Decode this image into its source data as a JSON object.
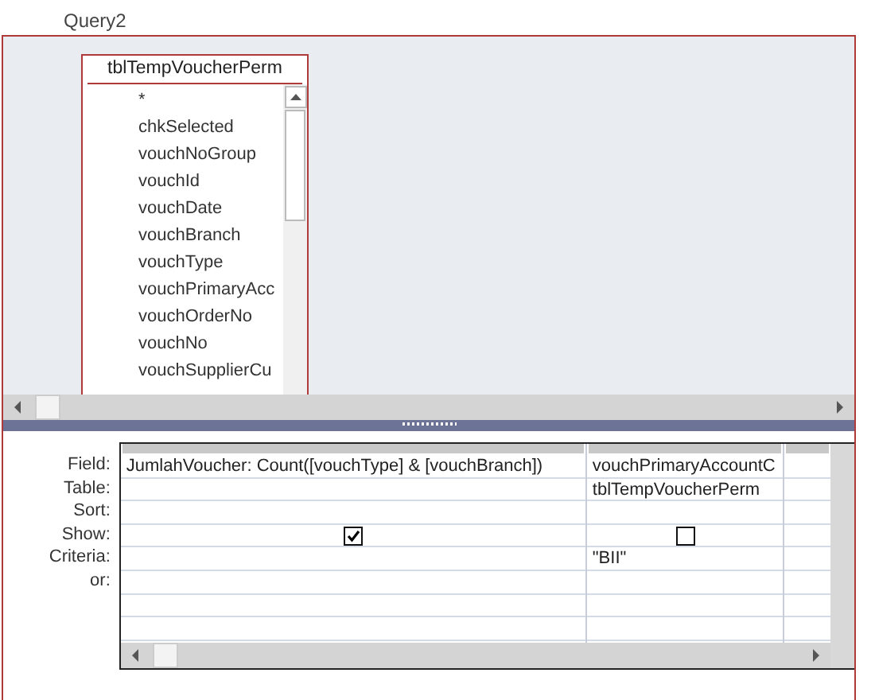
{
  "window": {
    "title": "Query2"
  },
  "table": {
    "title": "tblTempVoucherPerm",
    "fields": [
      "*",
      "chkSelected",
      "vouchNoGroup",
      "vouchId",
      "vouchDate",
      "vouchBranch",
      "vouchType",
      "vouchPrimaryAcc",
      "vouchOrderNo",
      "vouchNo",
      "vouchSupplierCu"
    ]
  },
  "grid": {
    "row_labels": [
      "Field:",
      "Table:",
      "Sort:",
      "Show:",
      "Criteria:",
      "or:"
    ],
    "columns": [
      {
        "field": "JumlahVoucher: Count([vouchType] & [vouchBranch])",
        "show": true
      },
      {
        "field": "vouchPrimaryAccountC",
        "table": "tblTempVoucherPerm",
        "show": false,
        "criteria": "\"BII\""
      }
    ]
  }
}
